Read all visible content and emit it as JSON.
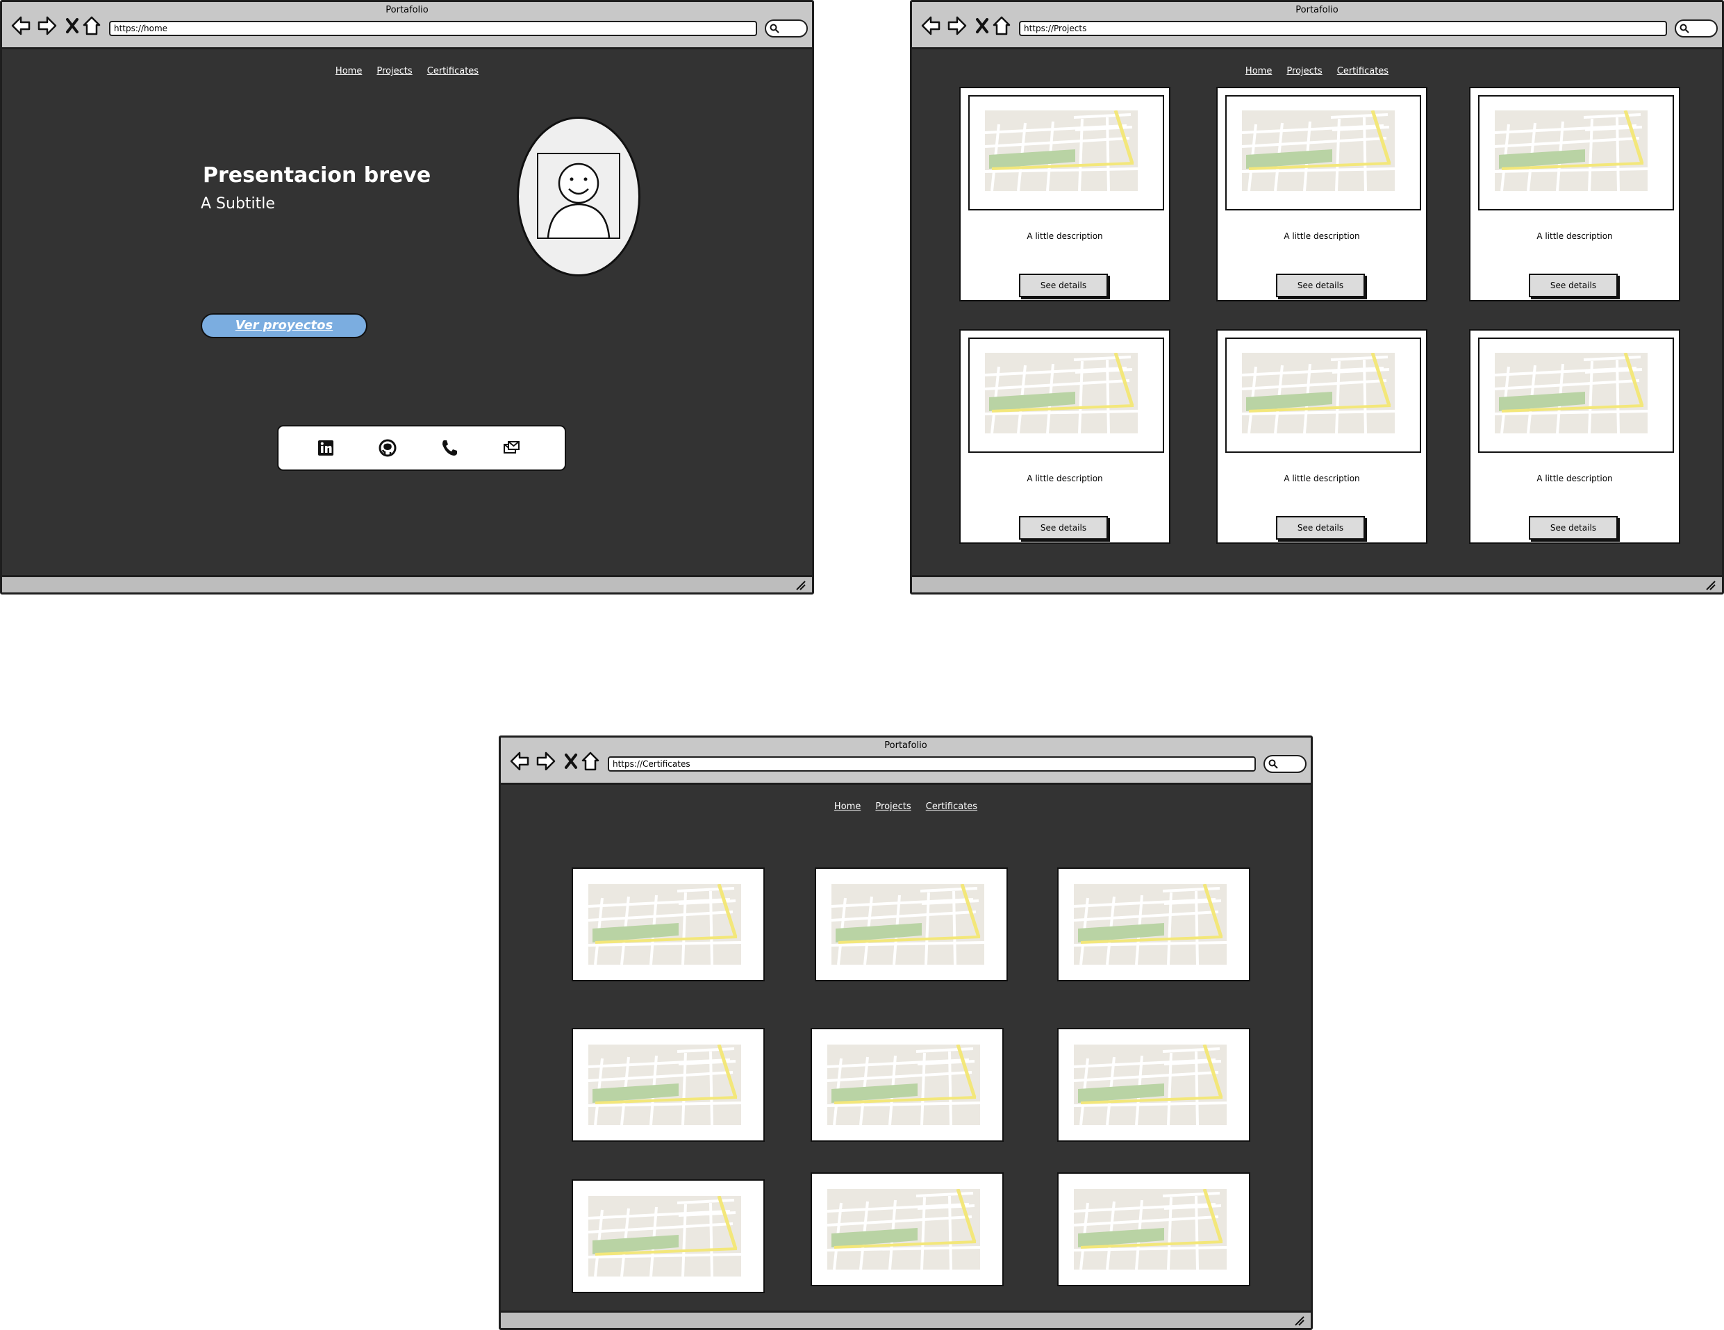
{
  "browser": {
    "title": "Portafolio"
  },
  "nav": {
    "home": "Home",
    "projects": "Projects",
    "certificates": "Certificates"
  },
  "home": {
    "url": "https://home",
    "title": "Presentacion breve",
    "subtitle": "A Subtitle",
    "cta": "Ver proyectos",
    "social_icons": [
      "linkedin-icon",
      "github-icon",
      "phone-icon",
      "email-icon"
    ]
  },
  "projects": {
    "url": "https://Projects",
    "cards": [
      {
        "description": "A little description",
        "button": "See details"
      },
      {
        "description": "A little description",
        "button": "See details"
      },
      {
        "description": "A little description",
        "button": "See details"
      },
      {
        "description": "A little description",
        "button": "See details"
      },
      {
        "description": "A little description",
        "button": "See details"
      },
      {
        "description": "A little description",
        "button": "See details"
      }
    ]
  },
  "certificates": {
    "url": "https://Certificates",
    "count": 9
  },
  "colors": {
    "page_bg": "#333333",
    "titlebar": "#c8c8c8",
    "accent": "#7bade0",
    "map_green": "#b9d3a4",
    "map_yellow": "#f3e77a"
  }
}
